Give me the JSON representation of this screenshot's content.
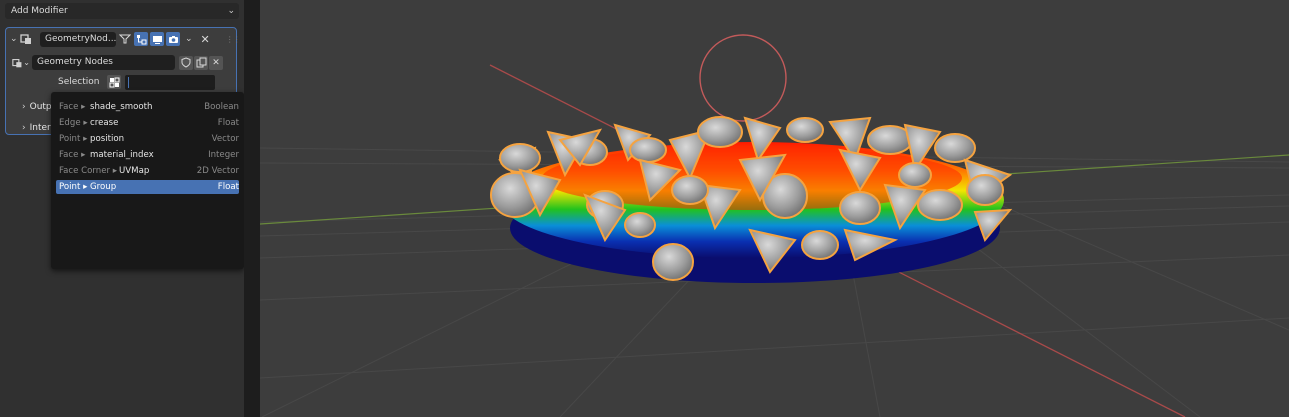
{
  "properties_panel": {
    "add_modifier_label": "Add Modifier",
    "modifier": {
      "name": "GeometryNod...",
      "node_group": "Geometry Nodes",
      "selection_label": "Selection",
      "sections": [
        "Outp",
        "Inter"
      ]
    }
  },
  "attribute_search": {
    "items": [
      {
        "domain": "Face ▸",
        "name": "shade_smooth",
        "type": "Boolean",
        "selected": false
      },
      {
        "domain": "Edge ▸",
        "name": "crease",
        "type": "Float",
        "selected": false
      },
      {
        "domain": "Point ▸",
        "name": "position",
        "type": "Vector",
        "selected": false
      },
      {
        "domain": "Face ▸",
        "name": "material_index",
        "type": "Integer",
        "selected": false
      },
      {
        "domain": "Face Corner ▸",
        "name": "UVMap",
        "type": "2D Vector",
        "selected": false
      },
      {
        "domain": "Point ▸",
        "name": "Group",
        "type": "Float",
        "selected": true
      }
    ]
  },
  "colors": {
    "accent": "#4772b3",
    "panel_bg": "#303030",
    "viewport_bg": "#3d3d3d",
    "selection_outline": "#f5a340",
    "x_axis": "#a84a4a",
    "y_axis": "#6a8a3c"
  }
}
